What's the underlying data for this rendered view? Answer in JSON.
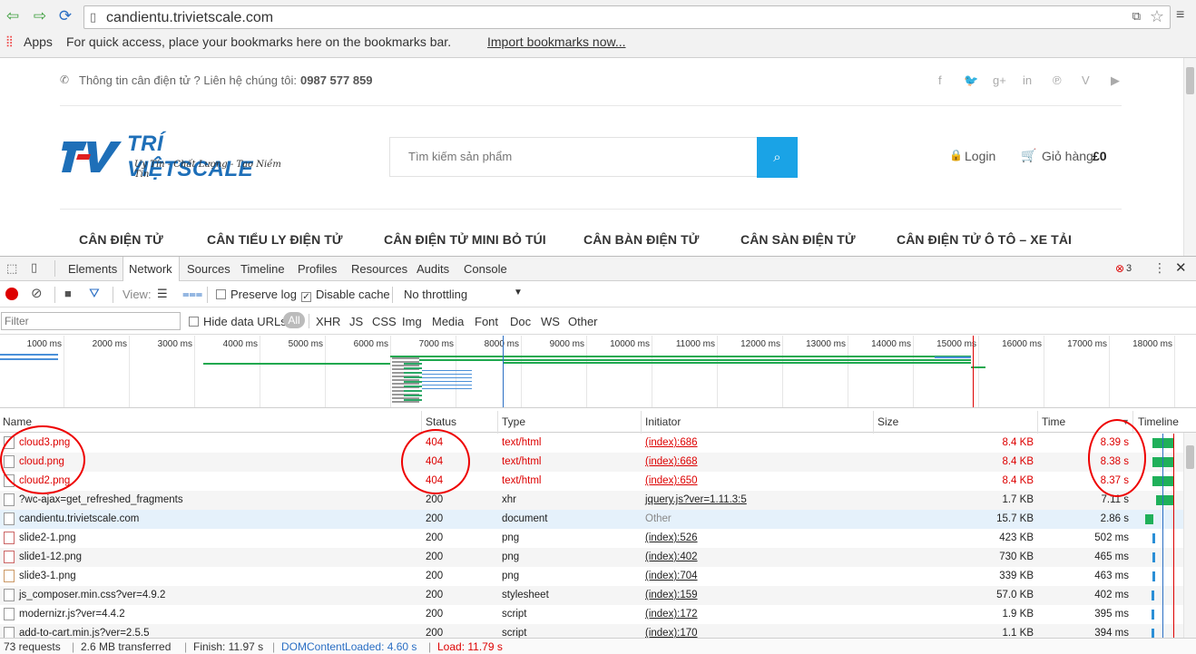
{
  "browser": {
    "url": "candientu.trivietscale.com",
    "bookmarks": {
      "apps": "Apps",
      "hint": "For quick access, place your bookmarks here on the bookmarks bar.",
      "import_link": "Import bookmarks now..."
    }
  },
  "site": {
    "contact_text": "Thông tin cân điện tử ? Liên hệ chúng tôi:",
    "phone": "0987 577 859",
    "logo_brand": "TRÍ VIỆTSCALE",
    "logo_tagline": "Uy Tín - Chất Lượng - Tạo Niềm Tin",
    "search_placeholder": "Tìm kiếm sản phẩm",
    "login": "Login",
    "cart_label": "Giỏ hàng",
    "cart_amount": "£0",
    "menu": [
      "CÂN ĐIỆN TỬ",
      "CÂN TIỂU LY ĐIỆN TỬ",
      "CÂN ĐIỆN TỬ MINI BỎ TÚI",
      "CÂN BÀN ĐIỆN TỬ",
      "CÂN SÀN ĐIỆN TỬ",
      "CÂN ĐIỆN TỬ Ô TÔ – XE TẢI"
    ]
  },
  "devtools": {
    "tabs": [
      "Elements",
      "Network",
      "Sources",
      "Timeline",
      "Profiles",
      "Resources",
      "Audits",
      "Console"
    ],
    "active_tab": "Network",
    "error_count": "3",
    "toolbar": {
      "view_label": "View:",
      "preserve_log": "Preserve log",
      "disable_cache": "Disable cache",
      "throttling": "No throttling"
    },
    "filter": {
      "placeholder": "Filter",
      "hide_data_urls": "Hide data URLs",
      "types": [
        "All",
        "XHR",
        "JS",
        "CSS",
        "Img",
        "Media",
        "Font",
        "Doc",
        "WS",
        "Other"
      ]
    },
    "timeline_ticks": [
      "1000 ms",
      "2000 ms",
      "3000 ms",
      "4000 ms",
      "5000 ms",
      "6000 ms",
      "7000 ms",
      "8000 ms",
      "9000 ms",
      "10000 ms",
      "11000 ms",
      "12000 ms",
      "13000 ms",
      "14000 ms",
      "15000 ms",
      "16000 ms",
      "17000 ms",
      "18000 ms"
    ],
    "columns": {
      "name": "Name",
      "status": "Status",
      "type": "Type",
      "initiator": "Initiator",
      "size": "Size",
      "time": "Time",
      "timeline": "Timeline"
    },
    "rows": [
      {
        "name": "cloud3.png",
        "status": "404",
        "type": "text/html",
        "initiator": "(index):686",
        "size": "8.4 KB",
        "time": "8.39 s"
      },
      {
        "name": "cloud.png",
        "status": "404",
        "type": "text/html",
        "initiator": "(index):668",
        "size": "8.4 KB",
        "time": "8.38 s"
      },
      {
        "name": "cloud2.png",
        "status": "404",
        "type": "text/html",
        "initiator": "(index):650",
        "size": "8.4 KB",
        "time": "8.37 s"
      },
      {
        "name": "?wc-ajax=get_refreshed_fragments",
        "status": "200",
        "type": "xhr",
        "initiator": "jquery.js?ver=1.11.3:5",
        "size": "1.7 KB",
        "time": "7.11 s"
      },
      {
        "name": "candientu.trivietscale.com",
        "status": "200",
        "type": "document",
        "initiator": "Other",
        "size": "15.7 KB",
        "time": "2.86 s"
      },
      {
        "name": "slide2-1.png",
        "status": "200",
        "type": "png",
        "initiator": "(index):526",
        "size": "423 KB",
        "time": "502 ms"
      },
      {
        "name": "slide1-12.png",
        "status": "200",
        "type": "png",
        "initiator": "(index):402",
        "size": "730 KB",
        "time": "465 ms"
      },
      {
        "name": "slide3-1.png",
        "status": "200",
        "type": "png",
        "initiator": "(index):704",
        "size": "339 KB",
        "time": "463 ms"
      },
      {
        "name": "js_composer.min.css?ver=4.9.2",
        "status": "200",
        "type": "stylesheet",
        "initiator": "(index):159",
        "size": "57.0 KB",
        "time": "402 ms"
      },
      {
        "name": "modernizr.js?ver=4.4.2",
        "status": "200",
        "type": "script",
        "initiator": "(index):172",
        "size": "1.9 KB",
        "time": "395 ms"
      },
      {
        "name": "add-to-cart.min.js?ver=2.5.5",
        "status": "200",
        "type": "script",
        "initiator": "(index):170",
        "size": "1.1 KB",
        "time": "394 ms"
      }
    ],
    "status_bar": {
      "requests": "73 requests",
      "transferred": "2.6 MB transferred",
      "finish": "Finish: 11.97 s",
      "dom_loaded": "DOMContentLoaded: 4.60 s",
      "load": "Load: 11.79 s"
    }
  }
}
